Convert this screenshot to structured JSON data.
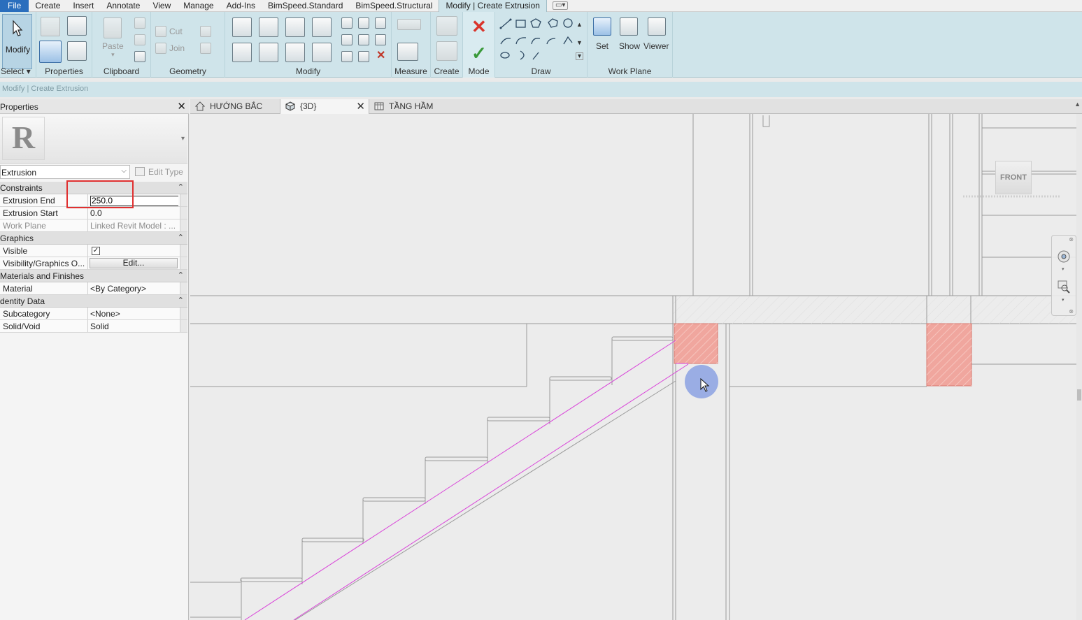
{
  "menu": {
    "file": "File",
    "items": [
      "Create",
      "Insert",
      "Annotate",
      "View",
      "Manage",
      "Add-Ins",
      "BimSpeed.Standard",
      "BimSpeed.Structural"
    ],
    "active": "Modify | Create Extrusion"
  },
  "ribbon": {
    "modify_label": "Modify",
    "select_label": "Select",
    "panels": {
      "properties": "Properties",
      "clipboard": "Clipboard",
      "geometry": "Geometry",
      "modify": "Modify",
      "measure": "Measure",
      "create": "Create",
      "mode": "Mode",
      "draw": "Draw",
      "work_plane": "Work Plane"
    },
    "clipboard": {
      "paste": "Paste"
    },
    "geometry": {
      "cut": "Cut",
      "join": "Join"
    },
    "work_plane": {
      "set": "Set",
      "show": "Show",
      "viewer": "Viewer"
    }
  },
  "context_bar": "Modify | Create Extrusion",
  "properties": {
    "title": "Properties",
    "type_name": "Extrusion",
    "edit_type": "Edit Type",
    "groups": {
      "constraints": "Constraints",
      "graphics": "Graphics",
      "materials": "Materials and Finishes",
      "identity": "dentity Data"
    },
    "rows": {
      "extrusion_end": {
        "label": "Extrusion End",
        "value": "250.0"
      },
      "extrusion_start": {
        "label": "Extrusion Start",
        "value": "0.0"
      },
      "work_plane": {
        "label": "Work Plane",
        "value": "Linked Revit Model : ..."
      },
      "visible": {
        "label": "Visible",
        "value": true
      },
      "vis_graphics": {
        "label": "Visibility/Graphics O...",
        "value": "Edit..."
      },
      "material": {
        "label": "Material",
        "value": "<By Category>"
      },
      "subcategory": {
        "label": "Subcategory",
        "value": "<None>"
      },
      "solid_void": {
        "label": "Solid/Void",
        "value": "Solid"
      }
    }
  },
  "view_tabs": [
    {
      "label": "HƯỚNG BẮC",
      "icon": "elevation-view-icon"
    },
    {
      "label": "{3D}",
      "icon": "3d-view-icon",
      "active": true
    },
    {
      "label": "TẦNG HẦM",
      "icon": "floor-plan-icon"
    }
  ],
  "viewcube": {
    "face": "FRONT"
  },
  "colors": {
    "ribbon": "#cfe4ea",
    "file_tab": "#2a6ebd",
    "extrusion_fill": "#f0a69e",
    "sketch_line": "#d946d9",
    "highlight": "#e03030"
  }
}
